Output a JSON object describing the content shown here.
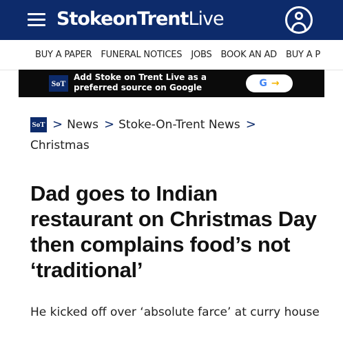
{
  "header": {
    "brand_bold": "StokeonTrent",
    "brand_light": "Live",
    "menu_icon": "hamburger-menu-icon",
    "account_icon": "user-account-icon"
  },
  "nav": {
    "items": [
      "BUY A PAPER",
      "FUNERAL NOTICES",
      "JOBS",
      "BOOK AN AD",
      "BUY A P"
    ]
  },
  "google_banner": {
    "logo_text": "SoT",
    "text": "Add Stoke on Trent Live as a preferred source on Google",
    "button_g": "G",
    "button_arrow": "→"
  },
  "breadcrumb": {
    "logo_text": "SoT",
    "separator": ">",
    "items": [
      "News",
      "Stoke-On-Trent News",
      "Christmas"
    ]
  },
  "article": {
    "headline": "Dad goes to Indian restaurant on Christmas Day then complains food’s not ‘traditional’",
    "standfirst": "He kicked off over ‘absolute farce’ at curry house"
  },
  "colors": {
    "header_bg": "#0d2b6b",
    "banner_bg": "#0b0b0b"
  }
}
